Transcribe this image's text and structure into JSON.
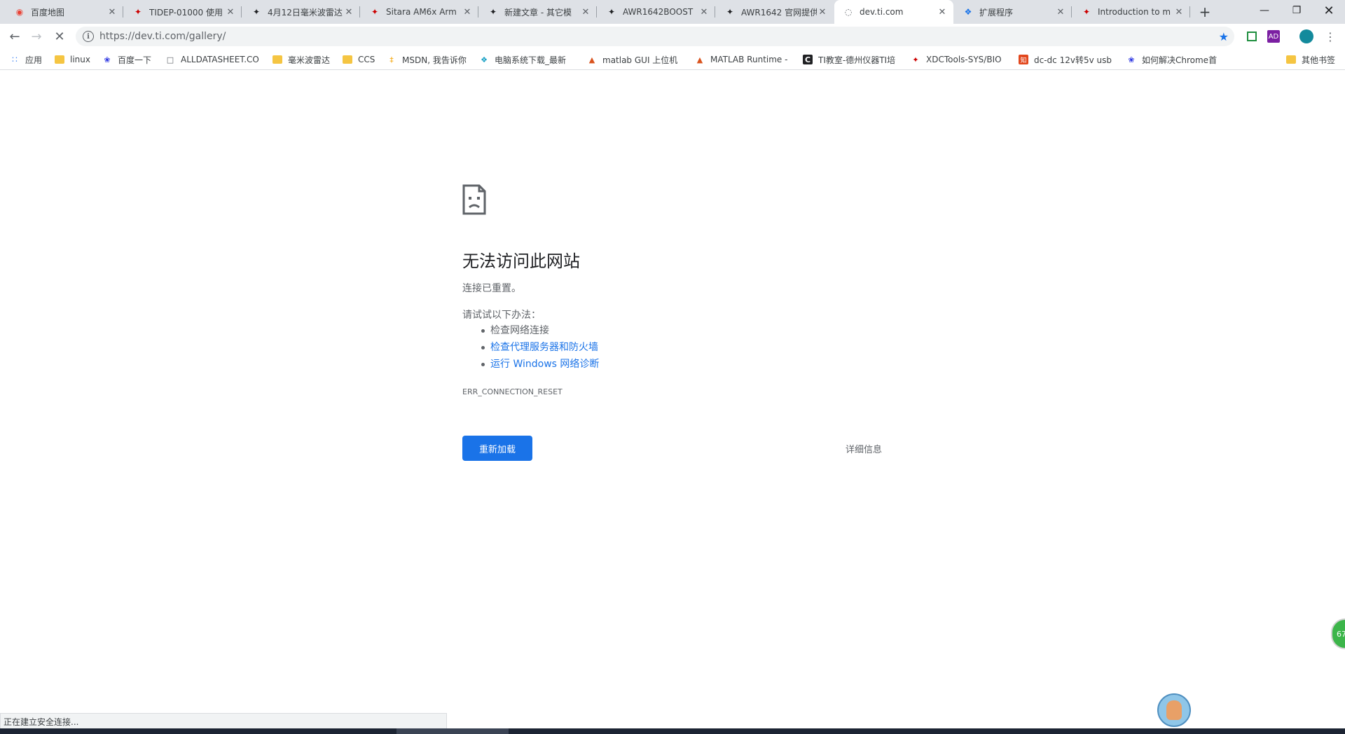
{
  "tabs": [
    {
      "title": "百度地图",
      "favicon": "map-pin-icon",
      "fav_color": "#e94235",
      "active": false
    },
    {
      "title": "TIDEP-01000 使用",
      "favicon": "ti-logo-icon",
      "fav_color": "#cc0000",
      "active": false
    },
    {
      "title": "4月12日毫米波雷达",
      "favicon": "ti-logo-icon",
      "fav_color": "#202124",
      "active": false
    },
    {
      "title": "Sitara AM6x Arm",
      "favicon": "ti-logo-icon",
      "fav_color": "#cc0000",
      "active": false
    },
    {
      "title": "新建文章 - 其它模",
      "favicon": "ti-logo-icon",
      "fav_color": "#202124",
      "active": false
    },
    {
      "title": "AWR1642BOOST",
      "favicon": "ti-logo-icon",
      "fav_color": "#202124",
      "active": false
    },
    {
      "title": "AWR1642 官网提供",
      "favicon": "ti-logo-icon",
      "fav_color": "#202124",
      "active": false
    },
    {
      "title": "dev.ti.com",
      "favicon": "loading-spinner-icon",
      "fav_color": "#5f6368",
      "active": true
    },
    {
      "title": "扩展程序",
      "favicon": "puzzle-icon",
      "fav_color": "#1a73e8",
      "active": false
    },
    {
      "title": "Introduction to m",
      "favicon": "ti-logo-icon",
      "fav_color": "#cc0000",
      "active": false
    }
  ],
  "omnibox": {
    "url": "https://dev.ti.com/gallery/"
  },
  "bookmarks": [
    {
      "label": "应用",
      "icon": "apps-grid-icon"
    },
    {
      "label": "linux",
      "icon": "folder-icon"
    },
    {
      "label": "百度一下",
      "icon": "baidu-paw-icon"
    },
    {
      "label": "ALLDATASHEET.CO",
      "icon": "page-icon"
    },
    {
      "label": "毫米波雷达",
      "icon": "folder-icon"
    },
    {
      "label": "CCS",
      "icon": "folder-icon"
    },
    {
      "label": "MSDN, 我告诉你",
      "icon": "msdn-icon"
    },
    {
      "label": "电脑系统下载_最新",
      "icon": "diamond-icon"
    },
    {
      "label": "matlab GUI 上位机",
      "icon": "matlab-icon"
    },
    {
      "label": "MATLAB Runtime -",
      "icon": "matlab-icon"
    },
    {
      "label": "TI教室-德州仪器TI培",
      "icon": "c-logo-icon"
    },
    {
      "label": "XDCTools-SYS/BIO",
      "icon": "ti-logo-icon"
    },
    {
      "label": "dc-dc 12v转5v usb",
      "icon": "zhihu-icon"
    },
    {
      "label": "如何解决Chrome首",
      "icon": "baidu-paw-icon"
    }
  ],
  "other_bookmarks": "其他书签",
  "error": {
    "title": "无法访问此网站",
    "subtitle": "连接已重置。",
    "try_label": "请试试以下办法：",
    "suggestions": [
      "检查网络连接",
      "检查代理服务器和防火墙",
      "运行 Windows 网络诊断"
    ],
    "code": "ERR_CONNECTION_RESET",
    "reload_label": "重新加载",
    "details_label": "详细信息"
  },
  "status_text": "正在建立安全连接...",
  "float_badge": "67",
  "colors": {
    "accent": "#1a73e8",
    "tabstrip": "#dee1e6"
  }
}
